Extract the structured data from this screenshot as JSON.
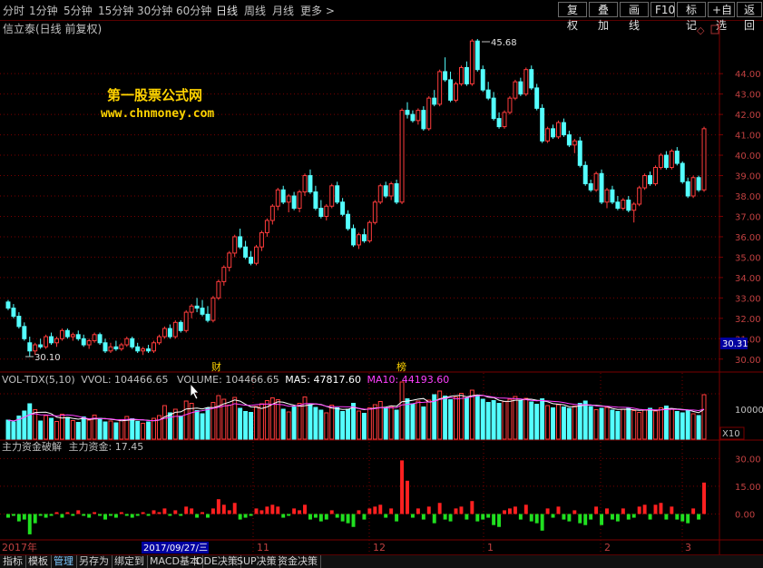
{
  "toolbar": {
    "periods": [
      "分时",
      "1分钟",
      "5分钟",
      "15分钟",
      "30分钟",
      "60分钟",
      "日线",
      "周线",
      "月线",
      "更多 >"
    ],
    "active_period": "日线",
    "buttons": [
      "复权",
      "叠加",
      "画线",
      "F10",
      "标记",
      "+自选",
      "返回"
    ]
  },
  "chart": {
    "stock_title": "信立泰(日线 前复权)",
    "watermark_line1": "第一股票公式网",
    "watermark_line2": "www.chnmoney.com",
    "high_label": "45.68",
    "low_label": "30.10",
    "current_price": "30.31",
    "price_ticks": [
      "44.00",
      "43.00",
      "42.00",
      "41.00",
      "40.00",
      "39.00",
      "38.00",
      "37.00",
      "36.00",
      "35.00",
      "34.00",
      "33.00",
      "32.00",
      "31.00",
      "30.00"
    ],
    "markers": [
      {
        "text": "财"
      },
      {
        "text": "榜"
      }
    ]
  },
  "volume_panel": {
    "indicator": "VOL-TDX(5,10)",
    "vvol": "VVOL: 104466.65",
    "volume": "VOLUME: 104466.65",
    "ma5": "MA5: 47817.60",
    "ma10": "MA10: 44193.60",
    "tick_10000": "10000",
    "unit": "X10"
  },
  "fund_panel": {
    "indicator": "主力资金破解",
    "value": "主力资金: 17.45",
    "ticks": [
      "30.00",
      "15.00",
      "0.00"
    ]
  },
  "date_axis": {
    "labels": [
      "2017年",
      "11",
      "12",
      "1",
      "2",
      "3"
    ],
    "cursor_date": "2017/09/27/三"
  },
  "bottom_tabs": [
    "指标",
    "模板",
    "管理",
    "另存为",
    "绑定到",
    "MACD基本",
    "DDE决策",
    "SUP决策",
    "资金决策"
  ],
  "colors": {
    "up": "#ff3c3c",
    "down": "#54ffff",
    "grid": "#7a0000",
    "axis": "#c0c0c0",
    "ma5": "#ffffff",
    "ma10": "#ff40ff",
    "wm": "#ffd400"
  },
  "chart_data": {
    "type": "candlestick",
    "ylim": [
      29.5,
      46.5
    ],
    "candles": [
      [
        32.8,
        32.9,
        32.4,
        32.5
      ],
      [
        32.5,
        32.7,
        32.0,
        32.1
      ],
      [
        32.1,
        32.3,
        31.5,
        31.6
      ],
      [
        31.6,
        31.8,
        30.9,
        31.0
      ],
      [
        30.8,
        31.1,
        30.1,
        30.4
      ],
      [
        30.4,
        30.8,
        30.2,
        30.7
      ],
      [
        30.7,
        31.0,
        30.5,
        30.6
      ],
      [
        30.6,
        31.2,
        30.5,
        31.1
      ],
      [
        31.1,
        31.3,
        30.7,
        30.8
      ],
      [
        30.8,
        31.1,
        30.6,
        31.0
      ],
      [
        31.0,
        31.5,
        30.9,
        31.4
      ],
      [
        31.4,
        31.5,
        31.0,
        31.1
      ],
      [
        31.1,
        31.3,
        30.9,
        31.2
      ],
      [
        31.2,
        31.4,
        30.9,
        31.0
      ],
      [
        31.0,
        31.2,
        30.6,
        30.7
      ],
      [
        30.7,
        31.0,
        30.5,
        30.9
      ],
      [
        30.9,
        31.3,
        30.8,
        31.2
      ],
      [
        31.2,
        31.3,
        30.7,
        30.8
      ],
      [
        30.8,
        31.0,
        30.3,
        30.4
      ],
      [
        30.4,
        30.8,
        30.3,
        30.6
      ],
      [
        30.6,
        30.9,
        30.4,
        30.5
      ],
      [
        30.5,
        30.8,
        30.4,
        30.7
      ],
      [
        30.7,
        31.1,
        30.6,
        31.0
      ],
      [
        31.0,
        31.1,
        30.5,
        30.6
      ],
      [
        30.6,
        30.8,
        30.3,
        30.4
      ],
      [
        30.4,
        30.6,
        30.2,
        30.5
      ],
      [
        30.5,
        30.7,
        30.3,
        30.4
      ],
      [
        30.4,
        30.9,
        30.3,
        30.8
      ],
      [
        30.8,
        31.2,
        30.7,
        31.1
      ],
      [
        31.1,
        31.6,
        31.0,
        31.5
      ],
      [
        31.5,
        31.7,
        31.0,
        31.1
      ],
      [
        31.1,
        31.9,
        31.0,
        31.8
      ],
      [
        31.8,
        31.9,
        31.3,
        31.4
      ],
      [
        31.4,
        32.4,
        31.3,
        32.3
      ],
      [
        32.3,
        32.7,
        32.0,
        32.6
      ],
      [
        32.6,
        33.0,
        32.3,
        32.5
      ],
      [
        32.5,
        32.9,
        32.1,
        32.2
      ],
      [
        32.2,
        32.6,
        31.8,
        31.9
      ],
      [
        31.9,
        33.1,
        31.8,
        33.0
      ],
      [
        33.0,
        33.9,
        32.9,
        33.8
      ],
      [
        33.8,
        34.6,
        33.6,
        34.5
      ],
      [
        34.5,
        35.3,
        34.3,
        35.2
      ],
      [
        35.2,
        36.1,
        35.0,
        36.0
      ],
      [
        36.0,
        36.4,
        35.4,
        35.5
      ],
      [
        35.5,
        35.8,
        34.9,
        35.0
      ],
      [
        35.0,
        35.3,
        34.6,
        34.7
      ],
      [
        34.7,
        35.6,
        34.6,
        35.5
      ],
      [
        35.5,
        36.3,
        35.3,
        36.2
      ],
      [
        36.2,
        36.9,
        36.0,
        36.8
      ],
      [
        36.8,
        37.6,
        36.6,
        37.5
      ],
      [
        37.5,
        38.4,
        37.3,
        38.3
      ],
      [
        38.3,
        38.5,
        37.6,
        37.7
      ],
      [
        37.7,
        38.1,
        37.2,
        38.0
      ],
      [
        38.0,
        38.2,
        37.3,
        37.4
      ],
      [
        37.4,
        38.3,
        37.2,
        38.2
      ],
      [
        38.2,
        39.1,
        38.0,
        39.0
      ],
      [
        39.0,
        39.3,
        38.1,
        38.2
      ],
      [
        38.2,
        38.5,
        37.3,
        37.4
      ],
      [
        37.4,
        37.8,
        36.9,
        37.0
      ],
      [
        37.0,
        37.6,
        36.8,
        37.5
      ],
      [
        37.5,
        38.6,
        37.4,
        38.5
      ],
      [
        38.5,
        38.7,
        37.6,
        37.7
      ],
      [
        37.7,
        37.9,
        37.0,
        37.1
      ],
      [
        37.1,
        37.3,
        36.3,
        36.4
      ],
      [
        36.4,
        36.6,
        35.5,
        35.6
      ],
      [
        35.6,
        36.2,
        35.4,
        36.1
      ],
      [
        36.1,
        36.4,
        35.7,
        35.8
      ],
      [
        35.8,
        36.8,
        35.7,
        36.7
      ],
      [
        36.7,
        37.8,
        36.6,
        37.7
      ],
      [
        37.7,
        38.6,
        37.6,
        38.5
      ],
      [
        38.5,
        38.7,
        37.9,
        38.0
      ],
      [
        38.0,
        38.7,
        37.8,
        38.6
      ],
      [
        38.6,
        38.8,
        37.6,
        37.7
      ],
      [
        37.7,
        42.3,
        37.6,
        42.2
      ],
      [
        42.2,
        42.6,
        41.8,
        42.0
      ],
      [
        42.0,
        42.2,
        41.6,
        41.7
      ],
      [
        41.7,
        42.3,
        41.5,
        42.2
      ],
      [
        42.2,
        42.4,
        41.2,
        41.3
      ],
      [
        41.3,
        42.9,
        41.2,
        42.8
      ],
      [
        42.8,
        43.2,
        42.4,
        42.5
      ],
      [
        42.5,
        44.2,
        42.4,
        44.1
      ],
      [
        44.1,
        44.8,
        43.6,
        43.7
      ],
      [
        43.7,
        44.1,
        42.6,
        42.7
      ],
      [
        42.7,
        43.6,
        42.6,
        43.5
      ],
      [
        43.5,
        44.4,
        43.4,
        44.3
      ],
      [
        44.3,
        44.6,
        43.4,
        43.5
      ],
      [
        43.5,
        45.7,
        43.4,
        45.6
      ],
      [
        45.6,
        45.7,
        44.1,
        44.2
      ],
      [
        44.2,
        44.4,
        43.1,
        43.2
      ],
      [
        43.2,
        43.6,
        42.7,
        42.8
      ],
      [
        42.8,
        43.1,
        41.7,
        41.8
      ],
      [
        41.8,
        42.1,
        41.3,
        41.4
      ],
      [
        41.4,
        42.2,
        41.3,
        42.1
      ],
      [
        42.1,
        42.9,
        42.0,
        42.8
      ],
      [
        42.8,
        43.7,
        42.7,
        43.6
      ],
      [
        43.6,
        43.8,
        42.9,
        43.0
      ],
      [
        43.0,
        44.3,
        42.9,
        44.2
      ],
      [
        44.2,
        44.4,
        43.2,
        43.3
      ],
      [
        43.3,
        43.5,
        42.2,
        42.3
      ],
      [
        42.3,
        42.5,
        40.6,
        40.7
      ],
      [
        40.7,
        41.4,
        40.6,
        41.3
      ],
      [
        41.3,
        41.5,
        40.8,
        40.9
      ],
      [
        40.9,
        41.7,
        40.8,
        41.6
      ],
      [
        41.6,
        41.8,
        40.9,
        41.0
      ],
      [
        41.0,
        41.2,
        40.4,
        40.5
      ],
      [
        40.5,
        40.8,
        40.1,
        40.7
      ],
      [
        40.7,
        40.9,
        39.4,
        39.5
      ],
      [
        39.5,
        39.7,
        38.5,
        38.6
      ],
      [
        38.6,
        38.8,
        38.2,
        38.3
      ],
      [
        38.3,
        39.2,
        38.2,
        39.1
      ],
      [
        39.1,
        39.3,
        37.6,
        37.7
      ],
      [
        37.7,
        38.4,
        37.4,
        38.3
      ],
      [
        38.3,
        38.5,
        37.6,
        37.7
      ],
      [
        37.7,
        38.0,
        37.3,
        37.4
      ],
      [
        37.4,
        37.9,
        37.3,
        37.8
      ],
      [
        37.8,
        38.0,
        37.2,
        37.3
      ],
      [
        37.3,
        37.7,
        36.7,
        37.6
      ],
      [
        37.6,
        38.5,
        37.5,
        38.4
      ],
      [
        38.4,
        39.1,
        38.3,
        39.0
      ],
      [
        39.0,
        39.2,
        38.5,
        38.6
      ],
      [
        38.6,
        39.5,
        38.5,
        39.4
      ],
      [
        39.4,
        40.1,
        39.3,
        40.0
      ],
      [
        40.0,
        40.2,
        39.3,
        39.4
      ],
      [
        39.4,
        40.3,
        39.3,
        40.2
      ],
      [
        40.2,
        40.4,
        39.5,
        39.6
      ],
      [
        39.6,
        39.7,
        38.6,
        38.7
      ],
      [
        38.7,
        38.9,
        37.9,
        38.0
      ],
      [
        38.0,
        39.0,
        37.9,
        38.9
      ],
      [
        38.9,
        39.0,
        38.2,
        38.3
      ],
      [
        38.3,
        41.4,
        38.2,
        41.3
      ]
    ],
    "volume": [
      4.2,
      3.8,
      5.1,
      6.2,
      7.8,
      6.5,
      4.0,
      5.2,
      4.6,
      3.9,
      5.5,
      4.8,
      4.1,
      3.7,
      4.9,
      4.2,
      5.3,
      4.6,
      3.8,
      4.0,
      3.6,
      4.3,
      5.0,
      4.5,
      3.9,
      3.5,
      3.8,
      4.6,
      5.2,
      7.4,
      5.8,
      6.6,
      5.1,
      8.4,
      7.9,
      6.3,
      5.6,
      6.8,
      8.1,
      9.6,
      8.8,
      7.5,
      9.2,
      6.8,
      6.1,
      5.9,
      7.2,
      7.8,
      8.5,
      9.1,
      8.7,
      6.6,
      6.0,
      7.1,
      7.9,
      9.3,
      7.6,
      7.0,
      6.4,
      5.8,
      7.5,
      6.9,
      6.1,
      6.6,
      7.9,
      6.2,
      5.7,
      6.9,
      7.6,
      8.3,
      6.8,
      7.2,
      6.4,
      12.6,
      8.9,
      7.8,
      8.4,
      7.1,
      8.6,
      9.8,
      10.6,
      9.5,
      8.7,
      9.3,
      10.1,
      9.0,
      10.8,
      9.6,
      8.8,
      8.1,
      8.5,
      7.9,
      8.3,
      8.8,
      9.4,
      8.6,
      9.0,
      8.2,
      7.7,
      8.9,
      7.4,
      6.9,
      7.6,
      7.1,
      6.8,
      7.3,
      7.9,
      8.4,
      7.2,
      6.5,
      6.8,
      7.0,
      6.4,
      6.1,
      6.6,
      6.9,
      6.3,
      5.9,
      6.4,
      6.8,
      6.2,
      6.9,
      7.3,
      6.7,
      6.1,
      5.8,
      6.4,
      5.6,
      5.2,
      9.8
    ],
    "vol_ylim": [
      0,
      13
    ],
    "fund": [
      -2,
      -1,
      -4,
      -3,
      -11,
      -5,
      -1,
      -2,
      -1,
      1,
      -2,
      1,
      -1,
      2,
      -1,
      -2,
      1,
      -1,
      -3,
      -1,
      -2,
      1,
      -1,
      -2,
      -1,
      1,
      -1,
      2,
      1,
      3,
      -1,
      2,
      -1,
      4,
      3,
      -2,
      1,
      -2,
      3,
      8,
      5,
      2,
      6,
      -3,
      -2,
      -1,
      3,
      2,
      4,
      5,
      4,
      -2,
      -1,
      3,
      2,
      5,
      -3,
      -2,
      -4,
      -3,
      2,
      -2,
      -4,
      -5,
      -7,
      2,
      -3,
      3,
      4,
      5,
      -2,
      3,
      -4,
      29,
      18,
      -2,
      3,
      -3,
      4,
      -5,
      6,
      -3,
      -4,
      3,
      4,
      -3,
      7,
      -4,
      -3,
      -2,
      -6,
      -7,
      2,
      3,
      4,
      -3,
      5,
      -4,
      -5,
      -9,
      3,
      -2,
      4,
      -3,
      -4,
      2,
      -5,
      -6,
      -3,
      4,
      -6,
      3,
      -3,
      -4,
      3,
      -3,
      -2,
      4,
      5,
      -3,
      5,
      6,
      -3,
      4,
      -3,
      -4,
      -5,
      3,
      -3,
      17
    ],
    "fund_ylim": [
      -14,
      40
    ]
  }
}
